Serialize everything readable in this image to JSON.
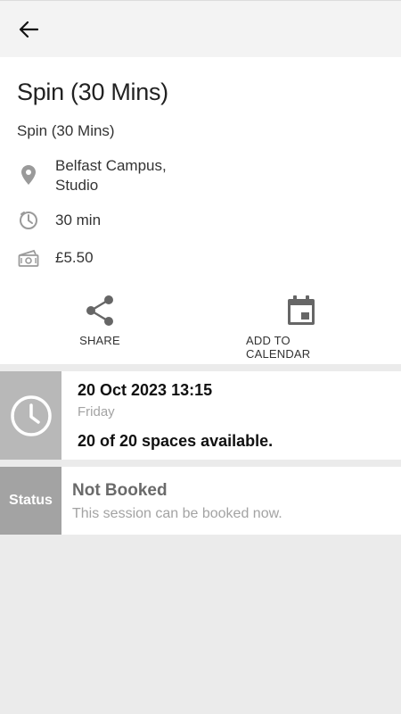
{
  "header": {
    "back_icon": "arrow-left-icon"
  },
  "class_info": {
    "title": "Spin (30 Mins)",
    "subtitle": "Spin (30 Mins)",
    "location_line1": "Belfast Campus,",
    "location_line2": "Studio",
    "duration": "30 min",
    "price": "£5.50"
  },
  "actions": {
    "share_label": "SHARE",
    "calendar_label": "ADD TO CALENDAR"
  },
  "session": {
    "datetime": "20 Oct 2023 13:15",
    "day": "Friday",
    "spaces": "20 of 20 spaces available."
  },
  "status": {
    "label": "Status",
    "title": "Not Booked",
    "description": "This session can be booked now."
  },
  "colors": {
    "header_bg": "#f3f3f3",
    "icon_gray": "#666666",
    "side_gray": "#b8b8b8",
    "status_gray": "#a3a3a3"
  }
}
